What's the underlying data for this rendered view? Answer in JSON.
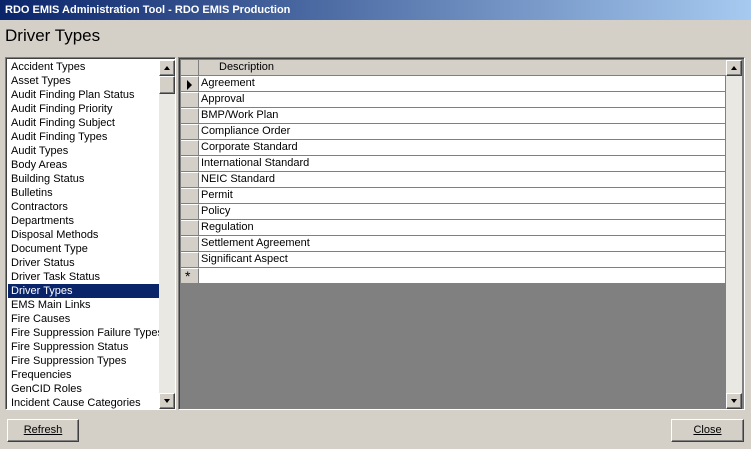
{
  "window": {
    "title": "RDO EMIS Administration Tool - RDO EMIS Production"
  },
  "page": {
    "heading": "Driver Types"
  },
  "sidebar": {
    "items": [
      {
        "label": "Accident Types",
        "selected": false
      },
      {
        "label": "Asset Types",
        "selected": false
      },
      {
        "label": "Audit Finding Plan Status",
        "selected": false
      },
      {
        "label": "Audit Finding Priority",
        "selected": false
      },
      {
        "label": "Audit Finding Subject",
        "selected": false
      },
      {
        "label": "Audit Finding Types",
        "selected": false
      },
      {
        "label": "Audit Types",
        "selected": false
      },
      {
        "label": "Body Areas",
        "selected": false
      },
      {
        "label": "Building Status",
        "selected": false
      },
      {
        "label": "Bulletins",
        "selected": false
      },
      {
        "label": "Contractors",
        "selected": false
      },
      {
        "label": "Departments",
        "selected": false
      },
      {
        "label": "Disposal Methods",
        "selected": false
      },
      {
        "label": "Document Type",
        "selected": false
      },
      {
        "label": "Driver Status",
        "selected": false
      },
      {
        "label": "Driver Task Status",
        "selected": false
      },
      {
        "label": "Driver Types",
        "selected": true
      },
      {
        "label": "EMS Main Links",
        "selected": false
      },
      {
        "label": "Fire Causes",
        "selected": false
      },
      {
        "label": "Fire Suppression Failure Types",
        "selected": false
      },
      {
        "label": "Fire Suppression Status",
        "selected": false
      },
      {
        "label": "Fire Suppression Types",
        "selected": false
      },
      {
        "label": "Frequencies",
        "selected": false
      },
      {
        "label": "GenCID Roles",
        "selected": false
      },
      {
        "label": "Incident Cause Categories",
        "selected": false
      }
    ]
  },
  "grid": {
    "columns": [
      "Description"
    ],
    "rows": [
      "Agreement",
      "Approval",
      "BMP/Work Plan",
      "Compliance Order",
      "Corporate Standard",
      "International Standard",
      "NEIC Standard",
      "Permit",
      "Policy",
      "Regulation",
      "Settlement Agreement",
      "Significant Aspect"
    ],
    "current_row_indicator": "▶",
    "new_row_indicator": "*"
  },
  "buttons": {
    "refresh_label": "Refresh",
    "close_label": "Close"
  },
  "colors": {
    "selection": "#0a246a",
    "window_bg": "#d4d0c8",
    "title_gradient_start": "#0a246a",
    "title_gradient_end": "#a6caf0"
  }
}
